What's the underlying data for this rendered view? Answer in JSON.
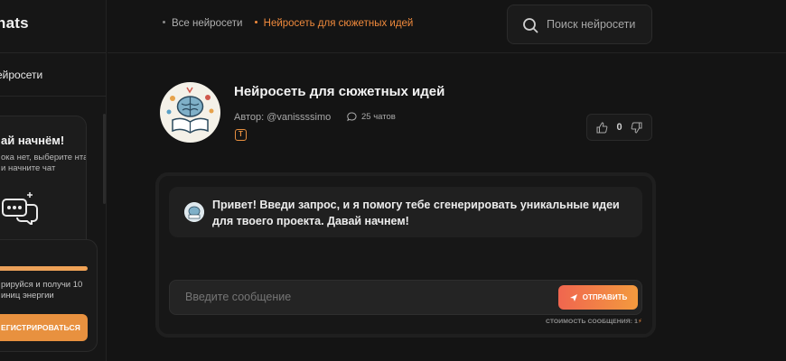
{
  "sidebar": {
    "brand": "hats",
    "nav_label": "ейросети",
    "promo": {
      "title": "ай начнём!",
      "text": "ока нет, выберите нта и начните чат",
      "icon": "chat-bot-icon"
    },
    "register": {
      "text": "рируйся и получи 10 иниц энергии",
      "button": "ЕГИСТРИРОВАТЬСЯ"
    }
  },
  "breadcrumb": {
    "items": [
      "Все нейросети",
      "Нейросеть для сюжетных идей"
    ]
  },
  "search": {
    "placeholder": "Поиск нейросети"
  },
  "bot": {
    "title": "Нейросеть для сюжетных идей",
    "author": "Автор: @vanissssimo",
    "chats": "25 чатов",
    "tag": "T",
    "likes": "0"
  },
  "chat": {
    "message": "Привет! Введи запрос, и я помогу тебе сгенерировать уникальные идеи для твоего проекта. Давай начнем!",
    "input_placeholder": "Введите сообщение",
    "send_label": "ОТПРАВИТЬ",
    "cost_label": "СТОИМОСТЬ СООБЩЕНИЯ: 1"
  },
  "colors": {
    "accent": "#f08a3c",
    "background": "#141414",
    "panel": "#1f1f1f"
  }
}
